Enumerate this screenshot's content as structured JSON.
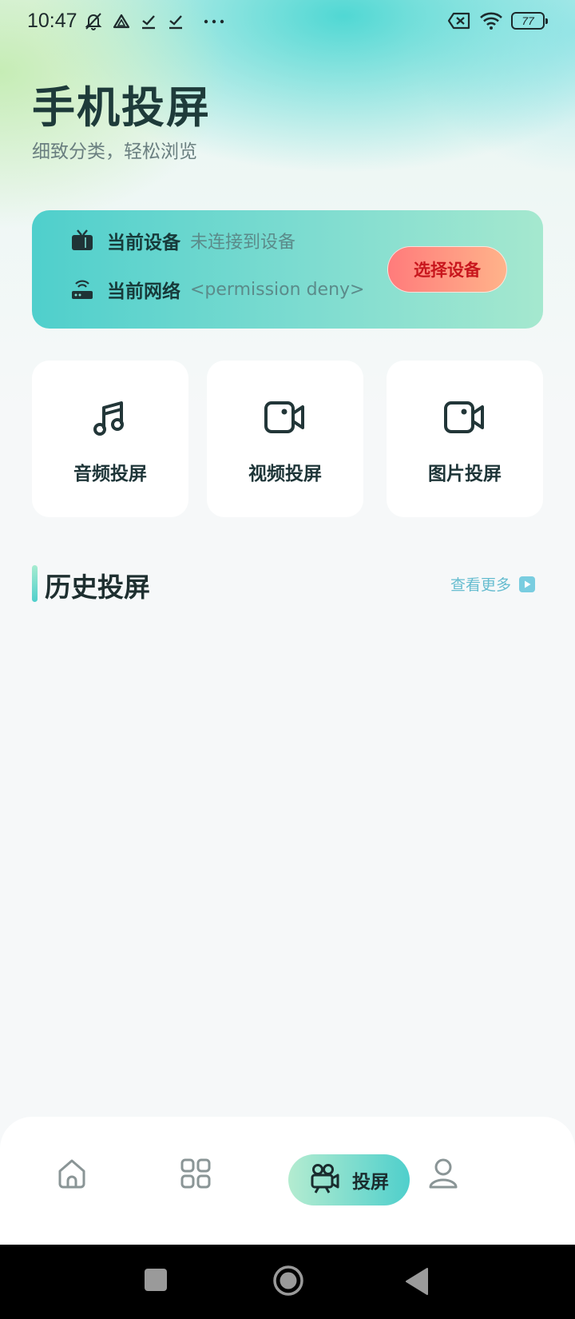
{
  "status_bar": {
    "time": "10:47",
    "left_icons": [
      "muted-alarm-icon",
      "drive-icon",
      "download-done-icon",
      "download-done-icon",
      "more-dots-icon"
    ],
    "right_icons": [
      "sim-disabled-icon",
      "wifi-icon",
      "battery-icon"
    ],
    "battery_level": "77"
  },
  "header": {
    "title": "手机投屏",
    "subtitle": "细致分类，轻松浏览"
  },
  "device_card": {
    "device_label": "当前设备",
    "device_value": "未连接到设备",
    "network_label": "当前网络",
    "network_value": "<permission deny>",
    "select_button": "选择设备",
    "device_icon": "tv-icon",
    "network_icon": "router-icon"
  },
  "features": [
    {
      "label": "音频投屏",
      "icon": "music-note-icon"
    },
    {
      "label": "视频投屏",
      "icon": "video-camera-icon"
    },
    {
      "label": "图片投屏",
      "icon": "video-camera-icon"
    }
  ],
  "history": {
    "title": "历史投屏",
    "view_more": "查看更多",
    "view_more_icon": "play-square-icon"
  },
  "bottom_nav": {
    "items": [
      {
        "icon": "home-icon"
      },
      {
        "icon": "grid-icon"
      },
      {
        "icon": "movie-camera-icon",
        "label": "投屏",
        "active": true
      },
      {
        "icon": "user-icon"
      }
    ]
  },
  "system_nav": {
    "buttons": [
      "recents-square-icon",
      "home-circle-icon",
      "back-triangle-icon"
    ]
  },
  "colors": {
    "accent_teal": "#4fcfcc",
    "button_red_text": "#c8161d",
    "link_blue": "#67bdd0",
    "title_dark": "#1e3b3a"
  }
}
